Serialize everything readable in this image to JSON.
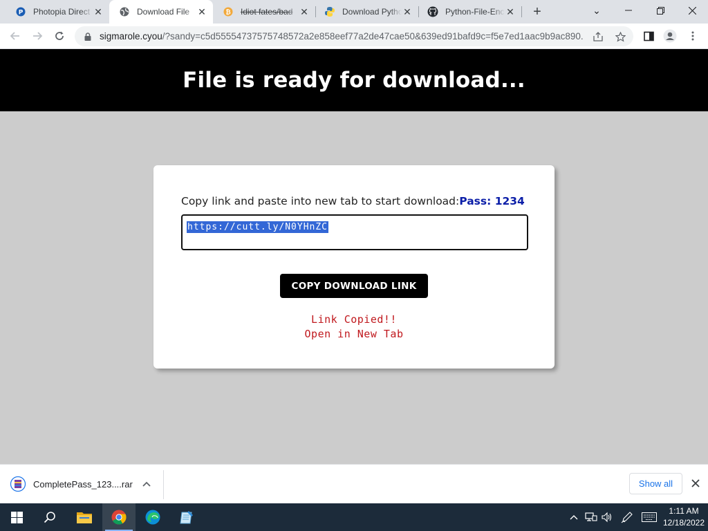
{
  "browser": {
    "tabs": [
      {
        "title": "Photopia Direct",
        "icon": "photopia-favicon",
        "active": false
      },
      {
        "title": "Download File",
        "icon": "globe-icon",
        "active": true
      },
      {
        "title": "Idiot fates/bad",
        "icon": "bitcoin-favicon",
        "active": false
      },
      {
        "title": "Download Pytho",
        "icon": "python-favicon",
        "active": false
      },
      {
        "title": "Python-File-Enc",
        "icon": "github-favicon",
        "active": false
      }
    ],
    "url_host": "sigmarole.cyou",
    "url_rest": "/?sandy=c5d55554737575748572a2e858eef77a2de47cae50&639ed91bafd9c=f5e7ed1aac9b9ac890..."
  },
  "page": {
    "header": "File is ready for download...",
    "instruction": "Copy link and paste into new tab to start download:",
    "pass_label": "Pass: 1234",
    "link_value": "https://cutt.ly/N0YHnZC",
    "copy_button": "COPY DOWNLOAD LINK",
    "status_copied": "Link Copied!!",
    "status_open": "Open in New Tab",
    "colors": {
      "header_bg": "#000000",
      "page_bg": "#cccccc",
      "pass": "#0b1ea8",
      "status": "#c0181d"
    }
  },
  "download_shelf": {
    "file_name": "CompletePass_123....rar",
    "show_all": "Show all"
  },
  "taskbar": {
    "time": "1:11 AM",
    "date": "12/18/2022",
    "apps": [
      "start-icon",
      "search-icon",
      "file-explorer-icon",
      "chrome-icon",
      "edge-icon",
      "notepad-icon"
    ]
  }
}
